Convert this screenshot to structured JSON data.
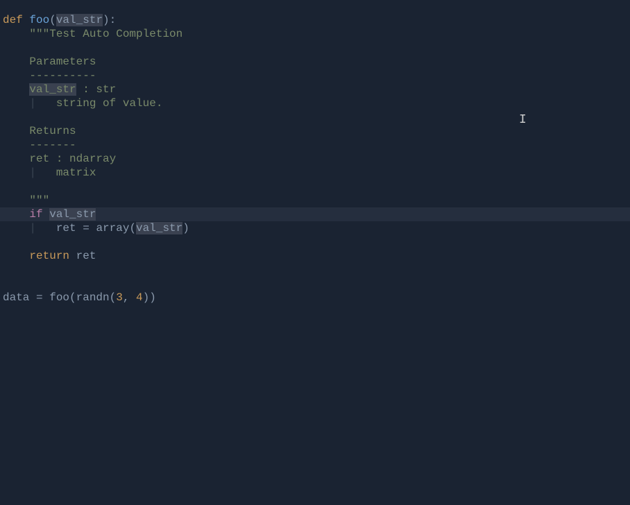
{
  "code": {
    "l1": {
      "def": "def ",
      "fn": "foo",
      "open": "(",
      "param": "val_str",
      "close": "):"
    },
    "l2": {
      "indent": "    ",
      "text": "\"\"\"Test Auto Completion"
    },
    "l3": "",
    "l4": {
      "indent": "    ",
      "text": "Parameters"
    },
    "l5": {
      "indent": "    ",
      "text": "----------"
    },
    "l6": {
      "indent": "    ",
      "param": "val_str",
      "rest": " : str"
    },
    "l7": {
      "indent": "    ",
      "guide": "|",
      "pad": "   ",
      "text": "string of value."
    },
    "l8": "",
    "l9": {
      "indent": "    ",
      "text": "Returns"
    },
    "l10": {
      "indent": "    ",
      "text": "-------"
    },
    "l11": {
      "indent": "    ",
      "text": "ret : ndarray"
    },
    "l12": {
      "indent": "    ",
      "guide": "|",
      "pad": "   ",
      "text": "matrix"
    },
    "l13": "",
    "l14": {
      "indent": "    ",
      "text": "\"\"\""
    },
    "l15": {
      "indent": "    ",
      "if": "if ",
      "param": "val_str"
    },
    "l16": {
      "indent": "    ",
      "guide": "|",
      "pad": "   ",
      "assign": "ret = array(",
      "param": "val_str",
      "close": ")"
    },
    "l17": "",
    "l18": {
      "indent": "    ",
      "return": "return ",
      "var": "ret"
    },
    "l19": "",
    "l20": "",
    "l21": {
      "pre": "data = foo(randn(",
      "n1": "3",
      "comma": ", ",
      "n2": "4",
      "close": "))"
    }
  },
  "cursor_char": "I"
}
